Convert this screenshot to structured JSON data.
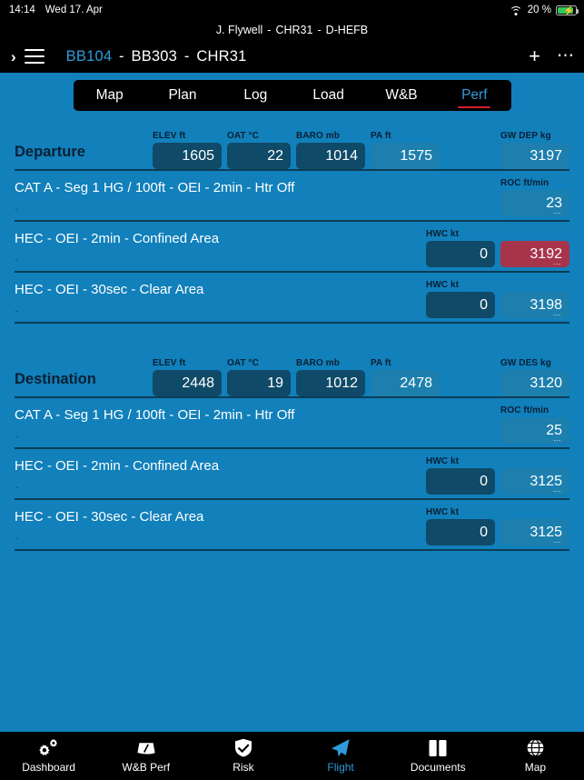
{
  "status_bar": {
    "time": "14:14",
    "date": "Wed 17. Apr",
    "wifi_icon": "wifi-icon",
    "battery_percent": "20 %",
    "battery_icon": "battery-charging-icon"
  },
  "header": {
    "crew_line": {
      "pilot": "J. Flywell",
      "callsign": "CHR31",
      "registration": "D-HEFB",
      "separator": "-"
    },
    "expand_icon": "chevron-right-icon",
    "menu_icon": "hamburger-menu-icon",
    "route": {
      "departure": "BB104",
      "destination": "BB303",
      "flight_id": "CHR31",
      "separator": "-"
    },
    "add_icon": "plus-icon",
    "more_icon": "ellipsis-icon"
  },
  "tabs": [
    {
      "label": "Map",
      "active": false
    },
    {
      "label": "Plan",
      "active": false
    },
    {
      "label": "Log",
      "active": false
    },
    {
      "label": "Load",
      "active": false
    },
    {
      "label": "W&B",
      "active": false
    },
    {
      "label": "Perf",
      "active": true
    }
  ],
  "sections": [
    {
      "title": "Departure",
      "fields": [
        {
          "label": "ELEV ft",
          "value": "1605",
          "style": "edit"
        },
        {
          "label": "OAT °C",
          "value": "22",
          "style": "edit"
        },
        {
          "label": "BARO mb",
          "value": "1014",
          "style": "edit"
        },
        {
          "label": "PA ft",
          "value": "1575",
          "style": "ro"
        }
      ],
      "gw": {
        "label": "GW DEP kg",
        "value": "3197",
        "style": "ro"
      },
      "rows": [
        {
          "title": "CAT A - Seg 1 HG / 100ft - OEI - 2min - Htr Off",
          "subtitle": "-",
          "hwc": null,
          "result": {
            "label": "ROC ft/min",
            "value": "23",
            "style": "ro",
            "dots": true
          }
        },
        {
          "title": "HEC - OEI - 2min - Confined Area",
          "subtitle": "-",
          "hwc": {
            "label": "HWC kt",
            "value": "0",
            "style": "edit"
          },
          "result": {
            "label": "",
            "value": "3192",
            "style": "warn",
            "dots": true
          }
        },
        {
          "title": "HEC - OEI - 30sec - Clear Area",
          "subtitle": "-",
          "hwc": {
            "label": "HWC kt",
            "value": "0",
            "style": "edit"
          },
          "result": {
            "label": "",
            "value": "3198",
            "style": "ro",
            "dots": true
          }
        }
      ]
    },
    {
      "title": "Destination",
      "fields": [
        {
          "label": "ELEV ft",
          "value": "2448",
          "style": "edit"
        },
        {
          "label": "OAT °C",
          "value": "19",
          "style": "edit"
        },
        {
          "label": "BARO mb",
          "value": "1012",
          "style": "edit"
        },
        {
          "label": "PA ft",
          "value": "2478",
          "style": "ro"
        }
      ],
      "gw": {
        "label": "GW DES kg",
        "value": "3120",
        "style": "ro"
      },
      "rows": [
        {
          "title": "CAT A - Seg 1 HG / 100ft - OEI - 2min - Htr Off",
          "subtitle": "-",
          "hwc": null,
          "result": {
            "label": "ROC ft/min",
            "value": "25",
            "style": "ro",
            "dots": true
          }
        },
        {
          "title": "HEC - OEI - 2min - Confined Area",
          "subtitle": "-",
          "hwc": {
            "label": "HWC kt",
            "value": "0",
            "style": "edit"
          },
          "result": {
            "label": "",
            "value": "3125",
            "style": "ro",
            "dots": true
          }
        },
        {
          "title": "HEC - OEI - 30sec - Clear Area",
          "subtitle": "-",
          "hwc": {
            "label": "HWC kt",
            "value": "0",
            "style": "edit"
          },
          "result": {
            "label": "",
            "value": "3125",
            "style": "ro",
            "dots": true
          }
        }
      ]
    }
  ],
  "bottom_nav": [
    {
      "label": "Dashboard",
      "icon": "gears-icon",
      "active": false
    },
    {
      "label": "W&B Perf",
      "icon": "scale-icon",
      "active": false
    },
    {
      "label": "Risk",
      "icon": "shield-check-icon",
      "active": false
    },
    {
      "label": "Flight",
      "icon": "paper-plane-icon",
      "active": true
    },
    {
      "label": "Documents",
      "icon": "book-icon",
      "active": false
    },
    {
      "label": "Map",
      "icon": "globe-icon",
      "active": false
    }
  ],
  "colors": {
    "page_background": "#1180bb",
    "bar_background": "#000000",
    "accent_blue": "#2f9bdb",
    "input_dark": "#0f4a68",
    "input_readonly": "#1d7fad",
    "warning_red": "#a8344c",
    "tab_underline": "#d11f2e",
    "divider": "#0d3c55",
    "battery_green": "#34c759"
  }
}
